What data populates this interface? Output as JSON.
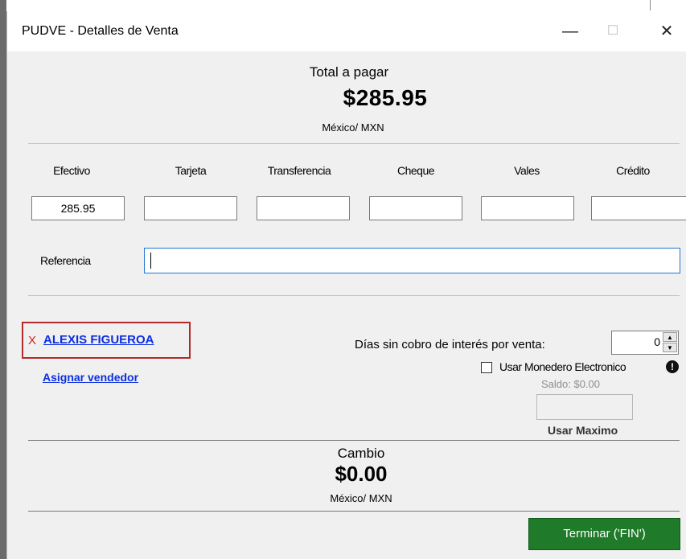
{
  "window": {
    "title": "PUDVE - Detalles de Venta",
    "controls": {
      "minimize": "—",
      "maximize": "☐",
      "close": "✕"
    }
  },
  "total": {
    "label": "Total a pagar",
    "amount": "$285.95",
    "currency": "México/ MXN"
  },
  "payment_methods": [
    {
      "label": "Efectivo",
      "value": "285.95"
    },
    {
      "label": "Tarjeta",
      "value": ""
    },
    {
      "label": "Transferencia",
      "value": ""
    },
    {
      "label": "Cheque",
      "value": ""
    },
    {
      "label": "Vales",
      "value": ""
    },
    {
      "label": "Crédito",
      "value": ""
    }
  ],
  "reference": {
    "label": "Referencia",
    "value": ""
  },
  "client": {
    "remove_mark": "X",
    "name": "ALEXIS FIGUEROA"
  },
  "seller": {
    "link": "Asignar vendedor"
  },
  "interest_free": {
    "label": "Días sin cobro de interés por venta:",
    "value": "0"
  },
  "wallet": {
    "checkbox_label": "Usar Monedero Electronico",
    "info_icon": "!",
    "balance": "Saldo: $0.00",
    "use_max": "Usar Maximo"
  },
  "change": {
    "label": "Cambio",
    "amount": "$0.00",
    "currency": "México/ MXN"
  },
  "finish_button": "Terminar ('FIN')",
  "colors": {
    "link": "#0b2ee0",
    "client_highlight": "#b22a2a",
    "finish_button": "#1f7a2a",
    "focus_border": "#1f78d1"
  }
}
